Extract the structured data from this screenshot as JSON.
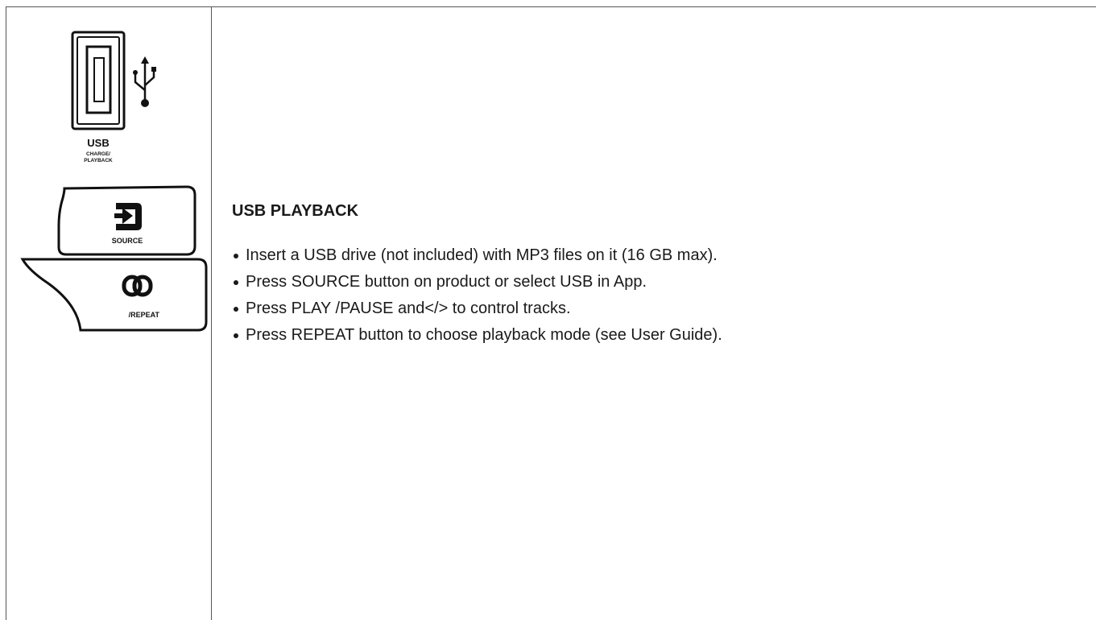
{
  "panel": {
    "usb_port": {
      "label": "USB",
      "sublabel_line1": "CHARGE/",
      "sublabel_line2": "PLAYBACK"
    },
    "source_button": {
      "label": "SOURCE",
      "icon": "source-arrow-icon"
    },
    "repeat_button": {
      "label": "/REPEAT",
      "icon": "repeat-link-icon"
    }
  },
  "section": {
    "title": "USB PLAYBACK",
    "steps": [
      "Insert a USB drive (not included) with MP3 files on it (16 GB max).",
      "Press SOURCE button on product or select USB in App.",
      "Press PLAY /PAUSE and</> to control tracks.",
      "Press REPEAT button to choose playback mode (see User Guide)."
    ]
  }
}
